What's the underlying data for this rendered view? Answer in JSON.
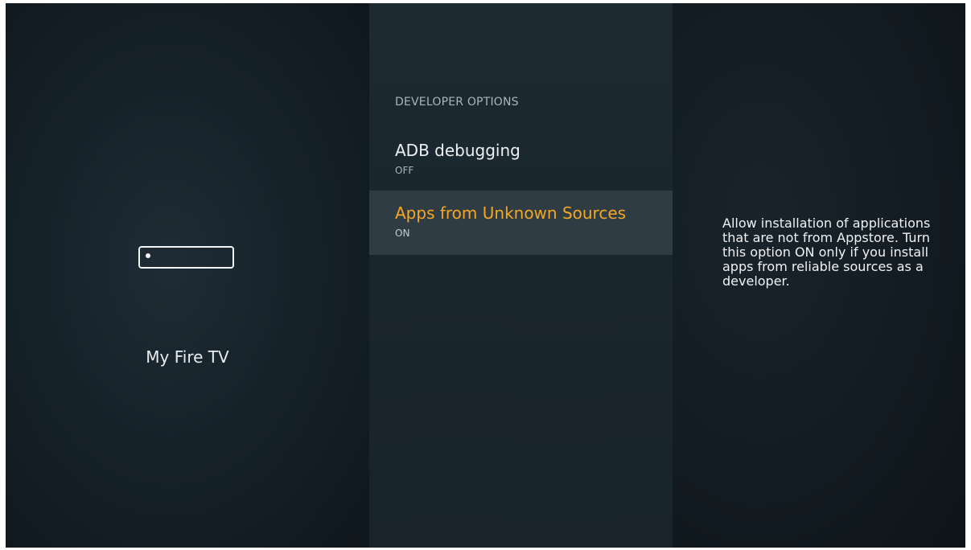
{
  "left_panel": {
    "device_icon": "fire-tv-device-icon",
    "device_name": "My Fire TV"
  },
  "menu": {
    "section_title": "DEVELOPER OPTIONS",
    "items": [
      {
        "label": "ADB debugging",
        "value": "OFF"
      },
      {
        "label": "Apps from Unknown Sources",
        "value": "ON"
      }
    ],
    "selected_index": 1
  },
  "info_panel": {
    "description": "Allow installation of applications that are not from Appstore. Turn this option ON only if you install apps from reliable sources as a developer."
  },
  "colors": {
    "accent": "#f5a623",
    "background": "#121c23",
    "highlight": "#2f3c44"
  }
}
